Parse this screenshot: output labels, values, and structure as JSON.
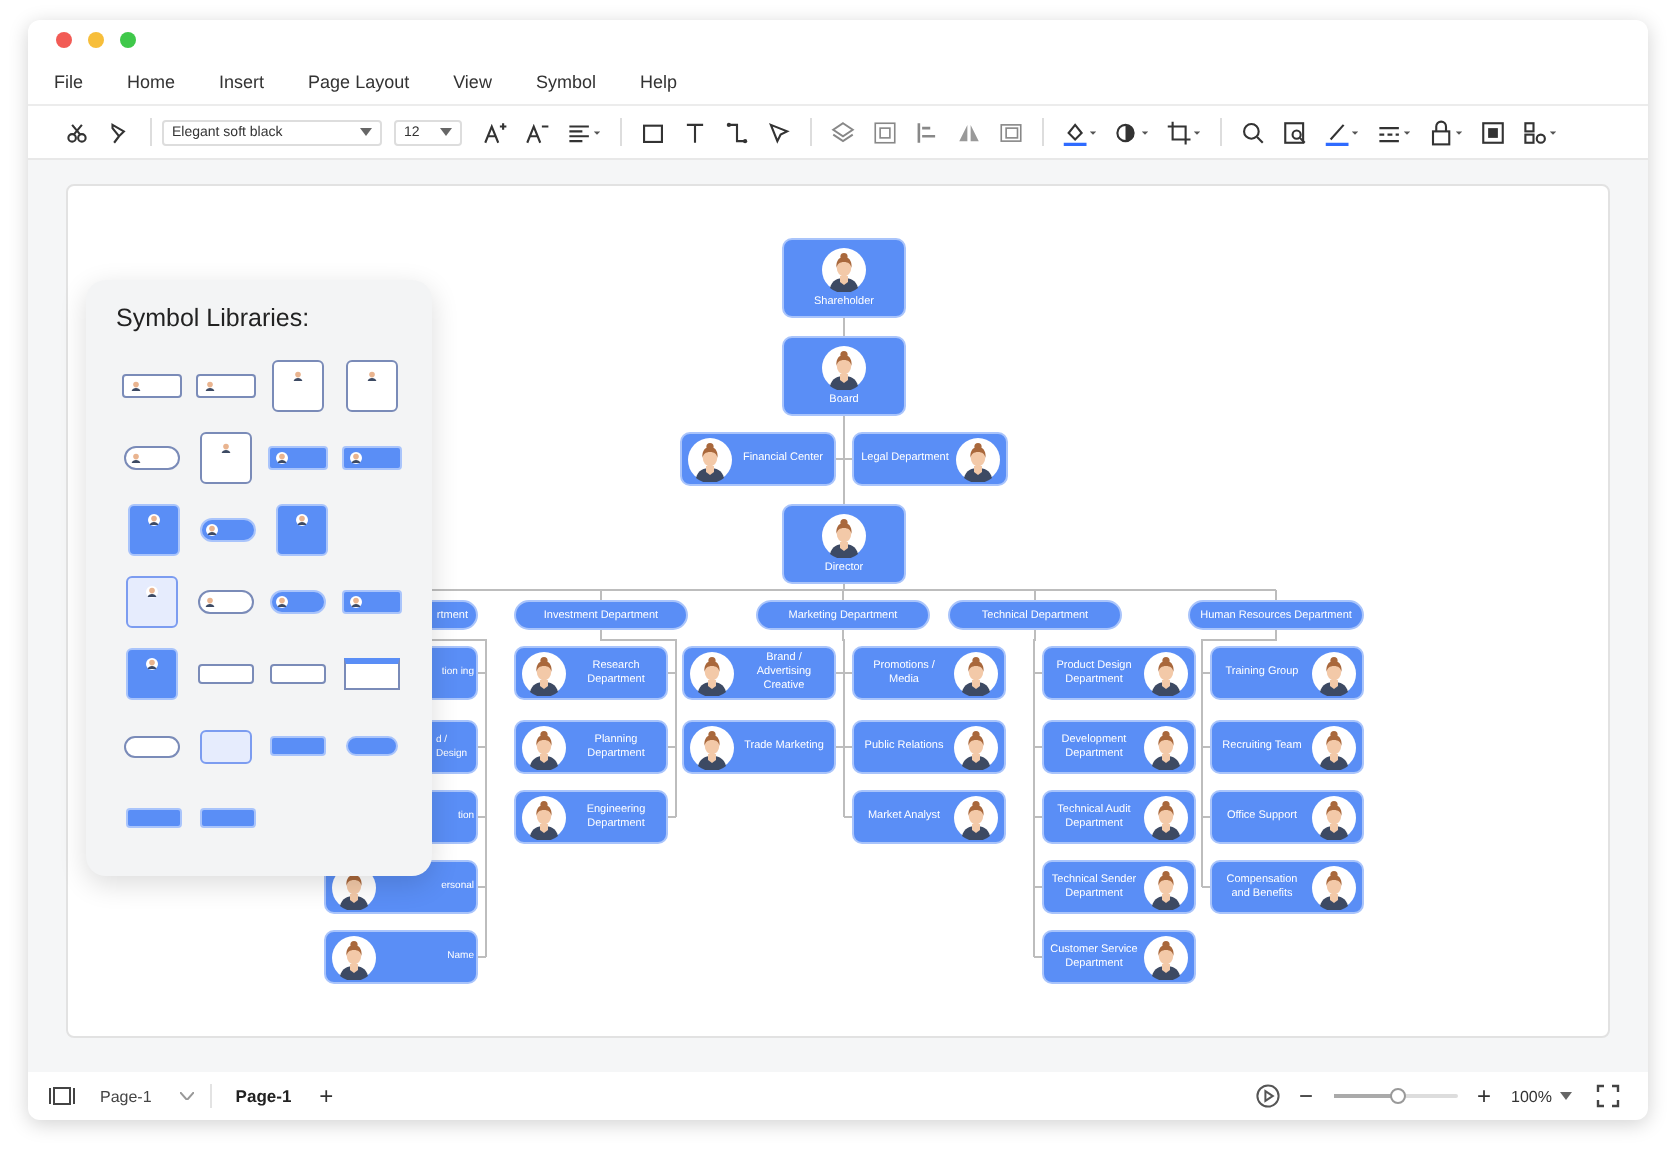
{
  "menu": [
    "File",
    "Home",
    "Insert",
    "Page Layout",
    "View",
    "Symbol",
    "Help"
  ],
  "toolbar": {
    "font": "Elegant soft black",
    "font_size": "12"
  },
  "symbol_libraries": {
    "title": "Symbol Libraries:",
    "rows": [
      {
        "items": [
          {
            "kind": "card-outline"
          },
          {
            "kind": "card-outline"
          },
          {
            "kind": "tall-outline"
          },
          {
            "kind": "tall-outline"
          }
        ]
      },
      {
        "items": [
          {
            "kind": "pill-outline"
          },
          {
            "kind": "tall-outline"
          },
          {
            "kind": "card-filled"
          },
          {
            "kind": "card-filled"
          }
        ]
      },
      {
        "items": [
          {
            "kind": "tall-filled"
          },
          {
            "kind": "pill-filled"
          },
          {
            "kind": "tall-filled"
          }
        ]
      },
      {
        "items": [
          {
            "kind": "tall-tinted"
          },
          {
            "kind": "pill-outline"
          },
          {
            "kind": "pill-filled"
          },
          {
            "kind": "card-filled"
          }
        ]
      },
      {
        "items": [
          {
            "kind": "tall-filled"
          },
          {
            "kind": "box-outline"
          },
          {
            "kind": "box-outline"
          },
          {
            "kind": "header-box"
          }
        ]
      },
      {
        "items": [
          {
            "kind": "round-outline"
          },
          {
            "kind": "box-tinted"
          },
          {
            "kind": "box-filled"
          },
          {
            "kind": "round-filled"
          }
        ]
      },
      {
        "items": [
          {
            "kind": "box-filled"
          },
          {
            "kind": "box-filled"
          }
        ]
      }
    ]
  },
  "org_chart": {
    "executives": [
      {
        "label": "Shareholder"
      },
      {
        "label": "Board"
      },
      {
        "label": "Director"
      }
    ],
    "staff_offices": [
      {
        "label": "Financial Center",
        "kind": "left-branch"
      },
      {
        "label": "Legal Department",
        "kind": "right-branch"
      }
    ],
    "departments": [
      {
        "label": "rtment",
        "children": [
          {
            "label": "tion ing",
            "kind": "left-branch"
          },
          {
            "label": "d / Design",
            "kind": "left-branch"
          },
          {
            "label": "tion",
            "kind": "left-branch"
          },
          {
            "label": "ersonal",
            "kind": "left-branch"
          },
          {
            "label": "Name",
            "kind": "left-branch"
          }
        ]
      },
      {
        "label": "Investment Department",
        "children": [
          {
            "label": "Research Department",
            "kind": "left-branch"
          },
          {
            "label": "Planning Department",
            "kind": "left-branch"
          },
          {
            "label": "Engineering Department",
            "kind": "left-branch"
          }
        ]
      },
      {
        "label": "Marketing Department",
        "children": [
          {
            "label": "Brand / Advertising Creative",
            "kind": "left-branch"
          },
          {
            "label": "Trade Marketing",
            "kind": "left-branch"
          },
          {
            "label": "Promotions / Media",
            "kind": "right-branch"
          },
          {
            "label": "Public Relations",
            "kind": "right-branch"
          },
          {
            "label": "Market Analyst",
            "kind": "right-branch"
          }
        ]
      },
      {
        "label": "Technical Department",
        "children": [
          {
            "label": "Product Design Department",
            "kind": "right-branch"
          },
          {
            "label": "Development Department",
            "kind": "right-branch"
          },
          {
            "label": "Technical Audit Department",
            "kind": "right-branch"
          },
          {
            "label": "Technical Sender Department",
            "kind": "right-branch"
          },
          {
            "label": "Customer Service Department",
            "kind": "right-branch"
          }
        ]
      },
      {
        "label": "Human Resources Department",
        "children": [
          {
            "label": "Training Group",
            "kind": "right-branch"
          },
          {
            "label": "Recruiting Team",
            "kind": "right-branch"
          },
          {
            "label": "Office Support",
            "kind": "right-branch"
          },
          {
            "label": "Compensation and Benefits",
            "kind": "right-branch"
          }
        ]
      }
    ]
  },
  "status_bar": {
    "page_select": "Page-1",
    "pages": [
      {
        "label": "Page-1",
        "selected": true
      }
    ],
    "add": "+",
    "zoom_out": "−",
    "zoom_in": "+",
    "zoom": {
      "level": 0.53
    },
    "zoom_value": "100%"
  }
}
